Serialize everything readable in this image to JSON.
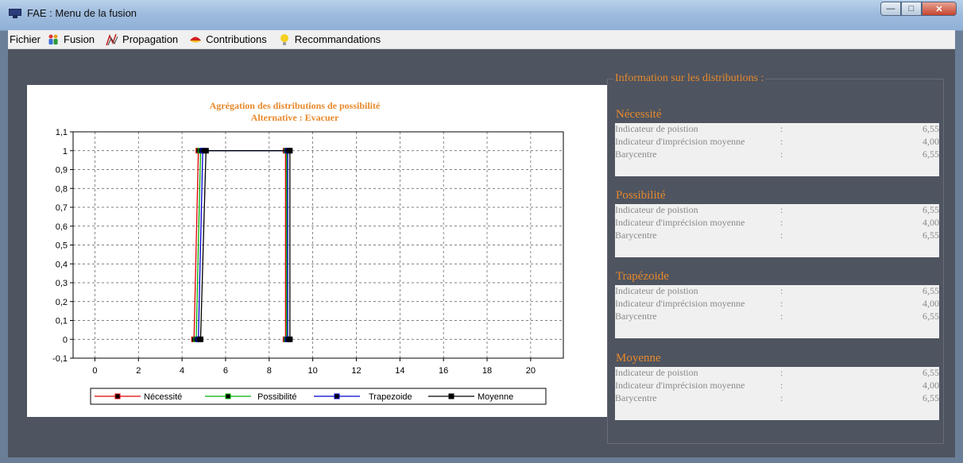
{
  "window": {
    "title": "FAE : Menu de la fusion"
  },
  "menu": {
    "items": [
      {
        "label": "Fichier",
        "icon": "none"
      },
      {
        "label": "Fusion",
        "icon": "people-icon"
      },
      {
        "label": "Propagation",
        "icon": "propagation-icon"
      },
      {
        "label": "Contributions",
        "icon": "contributions-icon"
      },
      {
        "label": "Recommandations",
        "icon": "lightbulb-icon"
      }
    ]
  },
  "chart_data": {
    "type": "line",
    "title": "Agrégation des distributions de possibilité",
    "subtitle": "Alternative : Evacuer",
    "xlim": [
      -1,
      21.5
    ],
    "ylim": [
      -0.1,
      1.1
    ],
    "x_ticks": [
      0,
      2,
      4,
      6,
      8,
      10,
      12,
      14,
      16,
      18,
      20
    ],
    "y_ticks": [
      "-0,1",
      "0",
      "0,1",
      "0,2",
      "0,3",
      "0,4",
      "0,5",
      "0,6",
      "0,7",
      "0,8",
      "0,9",
      "1",
      "1,1"
    ],
    "grid": true,
    "legend_position": "bottom",
    "series": [
      {
        "name": "Nécessité",
        "color": "#e00000",
        "x": [
          4.55,
          4.75,
          8.75,
          8.75
        ],
        "y": [
          0,
          1,
          1,
          0
        ]
      },
      {
        "name": "Possibilité",
        "color": "#00b000",
        "x": [
          4.65,
          4.85,
          8.8,
          8.8
        ],
        "y": [
          0,
          1,
          1,
          0
        ]
      },
      {
        "name": "Trapezoide",
        "color": "#0000d0",
        "x": [
          4.75,
          4.95,
          8.85,
          8.85
        ],
        "y": [
          0,
          1,
          1,
          0
        ]
      },
      {
        "name": "Moyenne",
        "color": "#000000",
        "x": [
          4.85,
          5.1,
          8.95,
          8.95
        ],
        "y": [
          0,
          1,
          1,
          0
        ]
      }
    ]
  },
  "info": {
    "title": "Information sur les distributions :",
    "sections": [
      {
        "title": "Nécessité",
        "rows": [
          {
            "label": "Indicateur de poistion",
            "sep": ":",
            "value": "6,55"
          },
          {
            "label": "Indicateur d'imprécision moyenne",
            "sep": ":",
            "value": "4,00"
          },
          {
            "label": "Barycentre",
            "sep": ":",
            "value": "6,55"
          }
        ]
      },
      {
        "title": "Possibilité",
        "rows": [
          {
            "label": "Indicateur de poistion",
            "sep": ":",
            "value": "6,55"
          },
          {
            "label": "Indicateur d'imprécision moyenne",
            "sep": ":",
            "value": "4,00"
          },
          {
            "label": "Barycentre",
            "sep": ":",
            "value": "6,55"
          }
        ]
      },
      {
        "title": "Trapézoide",
        "rows": [
          {
            "label": "Indicateur de poistion",
            "sep": ":",
            "value": "6,55"
          },
          {
            "label": "Indicateur d'imprécision moyenne",
            "sep": ":",
            "value": "4,00"
          },
          {
            "label": "Barycentre",
            "sep": ":",
            "value": "6,55"
          }
        ]
      },
      {
        "title": "Moyenne",
        "rows": [
          {
            "label": "Indicateur de poistion",
            "sep": ":",
            "value": "6,55"
          },
          {
            "label": "Indicateur d'imprécision moyenne",
            "sep": ":",
            "value": "4,00"
          },
          {
            "label": "Barycentre",
            "sep": ":",
            "value": "6,55"
          }
        ]
      }
    ]
  }
}
